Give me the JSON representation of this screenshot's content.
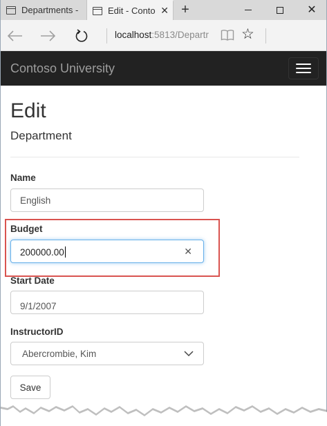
{
  "browser": {
    "tabs": [
      {
        "title": "Departments -",
        "active": false
      },
      {
        "title": "Edit - Conto",
        "active": true
      }
    ],
    "new_tab": "+",
    "url_host": "localhost",
    "url_rest": ":5813/Departr"
  },
  "site": {
    "brand": "Contoso University"
  },
  "page": {
    "title": "Edit",
    "subtitle": "Department"
  },
  "form": {
    "name_label": "Name",
    "name_value": "English",
    "budget_label": "Budget",
    "budget_value": "200000.00",
    "start_date_label": "Start Date",
    "start_date_value": "9/1/2007",
    "instructor_label": "InstructorID",
    "instructor_value": "Abercrombie, Kim",
    "save_label": "Save"
  },
  "colors": {
    "navbar": "#222222",
    "highlight": "#d9534f",
    "focus": "#66afe9"
  }
}
